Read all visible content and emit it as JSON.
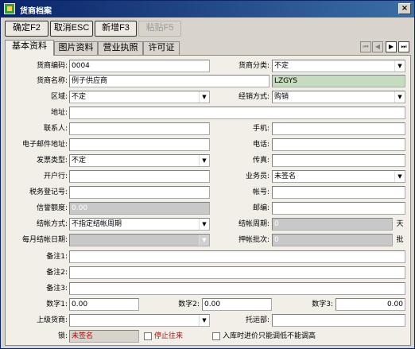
{
  "window": {
    "title": "货商档案",
    "close_label": "×"
  },
  "toolbar": {
    "ok": "确定F2",
    "cancel": "取消ESC",
    "add": "新增F3",
    "paste": "粘贴F5"
  },
  "tabs": [
    "基本资料",
    "图片资料",
    "营业执照",
    "许可证"
  ],
  "nav": {
    "first": "⏮",
    "prev": "◀",
    "next": "▶",
    "last": "⏭"
  },
  "form": {
    "code": {
      "label": "货商编码:",
      "value": "0004"
    },
    "category": {
      "label": "货商分类:",
      "value": "不定"
    },
    "name": {
      "label": "货商名称:",
      "value": "例子供应商"
    },
    "pinyin": {
      "value": "LZGYS"
    },
    "region": {
      "label": "区域:",
      "value": "不定"
    },
    "business_mode": {
      "label": "经销方式:",
      "value": "购销"
    },
    "address": {
      "label": "地址:",
      "value": ""
    },
    "contact": {
      "label": "联系人:",
      "value": ""
    },
    "mobile": {
      "label": "手机:",
      "value": ""
    },
    "email": {
      "label": "电子邮件地址:",
      "value": ""
    },
    "phone": {
      "label": "电话:",
      "value": ""
    },
    "invoice_type": {
      "label": "发票类型:",
      "value": "不定"
    },
    "fax": {
      "label": "传真:",
      "value": ""
    },
    "bank": {
      "label": "开户行:",
      "value": ""
    },
    "salesman": {
      "label": "业务员:",
      "value": "未签名"
    },
    "tax_no": {
      "label": "税务登记号:",
      "value": ""
    },
    "account": {
      "label": "帐号:",
      "value": ""
    },
    "credit": {
      "label": "信誉额度:",
      "value": "0.00"
    },
    "postcode": {
      "label": "邮编:",
      "value": ""
    },
    "settle_mode": {
      "label": "结帐方式:",
      "value": "不指定结帐周期"
    },
    "settle_cycle": {
      "label": "结帐周期:",
      "value": "0",
      "unit": "天"
    },
    "monthly_date": {
      "label": "每月结帐日期:",
      "value": ""
    },
    "pledge_batch": {
      "label": "押帐批次:",
      "value": "0",
      "unit": "批"
    },
    "note1": {
      "label": "备注1:",
      "value": ""
    },
    "note2": {
      "label": "备注2:",
      "value": ""
    },
    "note3": {
      "label": "备注3:",
      "value": ""
    },
    "num1": {
      "label": "数字1:",
      "value": "0.00"
    },
    "num2": {
      "label": "数字2:",
      "value": "0.00"
    },
    "num3": {
      "label": "数字3:",
      "value": "0.00"
    },
    "parent": {
      "label": "上级货商:",
      "value": ""
    },
    "consign": {
      "label": "托运部:",
      "value": ""
    },
    "lock": {
      "label": "锁:",
      "value": "未签名"
    },
    "stop": {
      "label": "停止往来"
    },
    "in_price": {
      "label": "入库时进价只能调低不能调高"
    }
  },
  "colors": {
    "title_bar": "#0a246a",
    "accent_red": "#c00000",
    "gray_field": "#c8c8c8",
    "green_field": "#c6dcc0"
  }
}
